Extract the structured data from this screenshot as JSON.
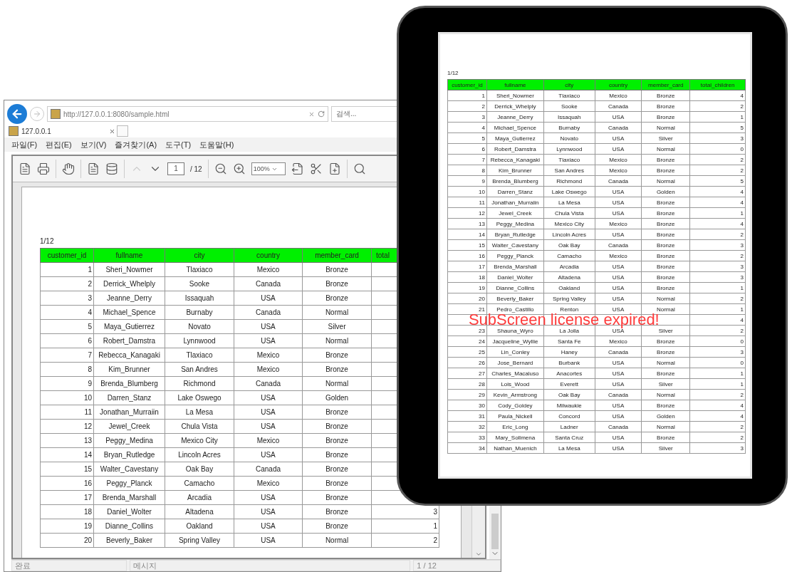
{
  "browser": {
    "address": "http://127.0.0.1:8080/sample.html",
    "search_placeholder": "검색...",
    "tab_title": "127.0.0.1",
    "menu": [
      "파일(F)",
      "편집(E)",
      "보기(V)",
      "즐겨찾기(A)",
      "도구(T)",
      "도움말(H)"
    ],
    "viewer_toolbar": {
      "page_input": "1",
      "page_total": "/ 12",
      "zoom": "100%"
    },
    "page_label": "1/12",
    "table": {
      "columns": [
        "customer_id",
        "fullname",
        "city",
        "country",
        "member_card",
        "total"
      ],
      "rows": [
        [
          "1",
          "Sheri_Nowmer",
          "Tlaxiaco",
          "Mexico",
          "Bronze"
        ],
        [
          "2",
          "Derrick_Whelply",
          "Sooke",
          "Canada",
          "Bronze"
        ],
        [
          "3",
          "Jeanne_Derry",
          "Issaquah",
          "USA",
          "Bronze"
        ],
        [
          "4",
          "Michael_Spence",
          "Burnaby",
          "Canada",
          "Normal"
        ],
        [
          "5",
          "Maya_Gutierrez",
          "Novato",
          "USA",
          "Silver"
        ],
        [
          "6",
          "Robert_Damstra",
          "Lynnwood",
          "USA",
          "Normal"
        ],
        [
          "7",
          "Rebecca_Kanagaki",
          "Tlaxiaco",
          "Mexico",
          "Bronze"
        ],
        [
          "8",
          "Kim_Brunner",
          "San Andres",
          "Mexico",
          "Bronze"
        ],
        [
          "9",
          "Brenda_Blumberg",
          "Richmond",
          "Canada",
          "Normal"
        ],
        [
          "10",
          "Darren_Stanz",
          "Lake Oswego",
          "USA",
          "Golden"
        ],
        [
          "11",
          "Jonathan_Murraiin",
          "La Mesa",
          "USA",
          "Bronze"
        ],
        [
          "12",
          "Jewel_Creek",
          "Chula Vista",
          "USA",
          "Bronze"
        ],
        [
          "13",
          "Peggy_Medina",
          "Mexico City",
          "Mexico",
          "Bronze"
        ],
        [
          "14",
          "Bryan_Rutledge",
          "Lincoln Acres",
          "USA",
          "Bronze"
        ],
        [
          "15",
          "Walter_Cavestany",
          "Oak Bay",
          "Canada",
          "Bronze"
        ],
        [
          "16",
          "Peggy_Planck",
          "Camacho",
          "Mexico",
          "Bronze"
        ],
        [
          "17",
          "Brenda_Marshall",
          "Arcadia",
          "USA",
          "Bronze"
        ],
        [
          "18",
          "Daniel_Wolter",
          "Altadena",
          "USA",
          "Bronze",
          "3"
        ],
        [
          "19",
          "Dianne_Collins",
          "Oakland",
          "USA",
          "Bronze",
          "1"
        ],
        [
          "20",
          "Beverly_Baker",
          "Spring Valley",
          "USA",
          "Normal",
          "2"
        ]
      ]
    },
    "status_bar": [
      "완료",
      "메시지",
      "1 / 12"
    ]
  },
  "tablet": {
    "page_label": "1/12",
    "table": {
      "columns": [
        "customer_id",
        "fullname",
        "city",
        "country",
        "member_card",
        "total_children"
      ],
      "rows": [
        [
          "1",
          "Sheri_Nowmer",
          "Tlaxiaco",
          "Mexico",
          "Bronze",
          "4"
        ],
        [
          "2",
          "Derrick_Whelply",
          "Sooke",
          "Canada",
          "Bronze",
          "2"
        ],
        [
          "3",
          "Jeanne_Derry",
          "Issaquah",
          "USA",
          "Bronze",
          "1"
        ],
        [
          "4",
          "Michael_Spence",
          "Burnaby",
          "Canada",
          "Normal",
          "5"
        ],
        [
          "5",
          "Maya_Gutierrez",
          "Novato",
          "USA",
          "Silver",
          "3"
        ],
        [
          "6",
          "Robert_Damstra",
          "Lynnwood",
          "USA",
          "Normal",
          "0"
        ],
        [
          "7",
          "Rebecca_Kanagaki",
          "Tlaxiaco",
          "Mexico",
          "Bronze",
          "2"
        ],
        [
          "8",
          "Kim_Brunner",
          "San Andres",
          "Mexico",
          "Bronze",
          "2"
        ],
        [
          "9",
          "Brenda_Blumberg",
          "Richmond",
          "Canada",
          "Normal",
          "5"
        ],
        [
          "10",
          "Darren_Stanz",
          "Lake Oswego",
          "USA",
          "Golden",
          "4"
        ],
        [
          "11",
          "Jonathan_Murraiin",
          "La Mesa",
          "USA",
          "Bronze",
          "4"
        ],
        [
          "12",
          "Jewel_Creek",
          "Chula Vista",
          "USA",
          "Bronze",
          "1"
        ],
        [
          "13",
          "Peggy_Medina",
          "Mexico City",
          "Mexico",
          "Bronze",
          "4"
        ],
        [
          "14",
          "Bryan_Rutledge",
          "Lincoln Acres",
          "USA",
          "Bronze",
          "2"
        ],
        [
          "15",
          "Walter_Cavestany",
          "Oak Bay",
          "Canada",
          "Bronze",
          "3"
        ],
        [
          "16",
          "Peggy_Planck",
          "Camacho",
          "Mexico",
          "Bronze",
          "2"
        ],
        [
          "17",
          "Brenda_Marshall",
          "Arcadia",
          "USA",
          "Bronze",
          "3"
        ],
        [
          "18",
          "Daniel_Wolter",
          "Altadena",
          "USA",
          "Bronze",
          "3"
        ],
        [
          "19",
          "Dianne_Collins",
          "Oakland",
          "USA",
          "Bronze",
          "1"
        ],
        [
          "20",
          "Beverly_Baker",
          "Spring Valley",
          "USA",
          "Normal",
          "2"
        ],
        [
          "21",
          "Pedro_Castillo",
          "Renton",
          "USA",
          "Normal",
          "1"
        ],
        [
          null,
          null,
          null,
          null,
          null,
          "4"
        ],
        [
          "23",
          "Shauna_Wyro",
          "La Jolla",
          "USA",
          "Silver",
          "2"
        ],
        [
          "24",
          "Jacqueline_Wyllie",
          "Santa Fe",
          "Mexico",
          "Bronze",
          "0"
        ],
        [
          "25",
          "Lin_Conley",
          "Haney",
          "Canada",
          "Bronze",
          "3"
        ],
        [
          "26",
          "Jose_Bernard",
          "Burbank",
          "USA",
          "Normal",
          "0"
        ],
        [
          "27",
          "Charles_Macaluso",
          "Anacortes",
          "USA",
          "Bronze",
          "1"
        ],
        [
          "28",
          "Lois_Wood",
          "Everett",
          "USA",
          "Silver",
          "1"
        ],
        [
          "29",
          "Kevin_Armstrong",
          "Oak Bay",
          "Canada",
          "Normal",
          "2"
        ],
        [
          "30",
          "Cody_Goldey",
          "Milwaukie",
          "USA",
          "Bronze",
          "4"
        ],
        [
          "31",
          "Paula_Nickell",
          "Concord",
          "USA",
          "Golden",
          "4"
        ],
        [
          "32",
          "Eric_Long",
          "Ladner",
          "Canada",
          "Normal",
          "2"
        ],
        [
          "33",
          "Mary_Sollmena",
          "Santa Cruz",
          "USA",
          "Bronze",
          "2"
        ],
        [
          "34",
          "Nathan_Muenich",
          "La Mesa",
          "USA",
          "Silver",
          "3"
        ]
      ]
    },
    "overlay": "SubScreen license expired!"
  }
}
